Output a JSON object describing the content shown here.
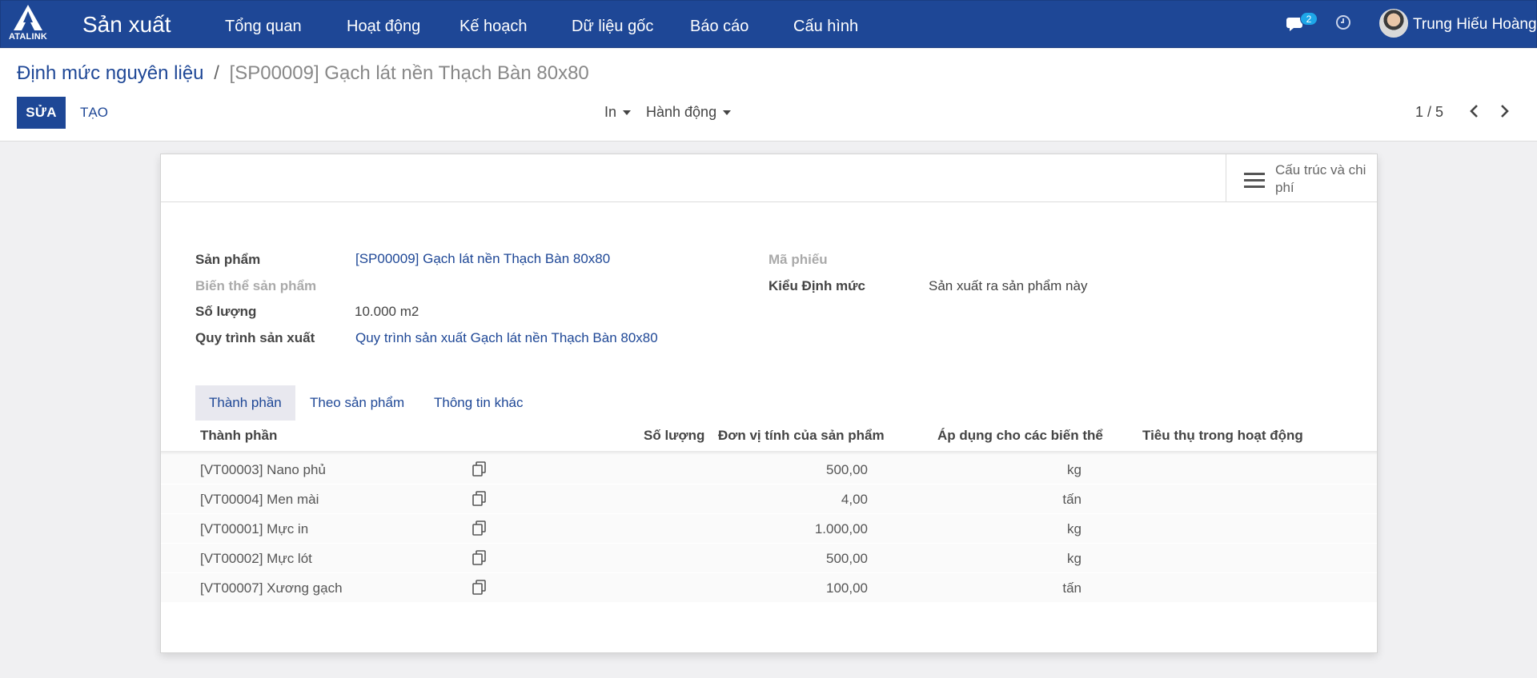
{
  "navbar": {
    "logo_text": "ATALINK",
    "app_title": "Sản xuất",
    "menu": [
      "Tổng quan",
      "Hoạt động",
      "Kế hoạch",
      "Dữ liệu gốc",
      "Báo cáo",
      "Cấu hình"
    ],
    "chat_count": "2",
    "user_name": "Trung Hiếu Hoàng",
    "colors": {
      "navbar_bg": "#1e4796",
      "badge": "#1ea7e8"
    }
  },
  "breadcrumb": {
    "parent": "Định mức nguyên liệu",
    "separator": "/",
    "current": "[SP00009] Gạch lát nền Thạch Bàn 80x80"
  },
  "toolbar": {
    "edit_label": "SỬA",
    "create_label": "TẠO",
    "print_label": "In",
    "action_label": "Hành động",
    "pager": "1 / 5"
  },
  "stat_button": {
    "label": "Cấu trúc và chi phí",
    "icon": "bars-icon"
  },
  "form": {
    "product_label": "Sản phẩm",
    "product_value": "[SP00009] Gạch lát nền Thạch Bàn 80x80",
    "variant_label": "Biến thể sản phẩm",
    "quantity_label": "Số lượng",
    "quantity_value": "10.000 m2",
    "routing_label": "Quy trình sản xuất",
    "routing_value": "Quy trình sản xuất Gạch lát nền Thạch Bàn 80x80",
    "code_label": "Mã phiếu",
    "type_label": "Kiểu Định mức",
    "type_value": "Sản xuất ra sản phẩm này"
  },
  "tabs": [
    "Thành phần",
    "Theo sản phẩm",
    "Thông tin khác"
  ],
  "table": {
    "headers": [
      "Thành phần",
      "Số lượng",
      "Đơn vị tính của sản phẩm",
      "Áp dụng cho các biến thể",
      "Tiêu thụ trong hoạt động"
    ],
    "rows": [
      {
        "component": "[VT00003] Nano phủ",
        "qty": "500,00",
        "uom": "kg"
      },
      {
        "component": "[VT00004] Men mài",
        "qty": "4,00",
        "uom": "tấn"
      },
      {
        "component": "[VT00001] Mực in",
        "qty": "1.000,00",
        "uom": "kg"
      },
      {
        "component": "[VT00002] Mực lót",
        "qty": "500,00",
        "uom": "kg"
      },
      {
        "component": "[VT00007] Xương gạch",
        "qty": "100,00",
        "uom": "tấn"
      }
    ]
  }
}
